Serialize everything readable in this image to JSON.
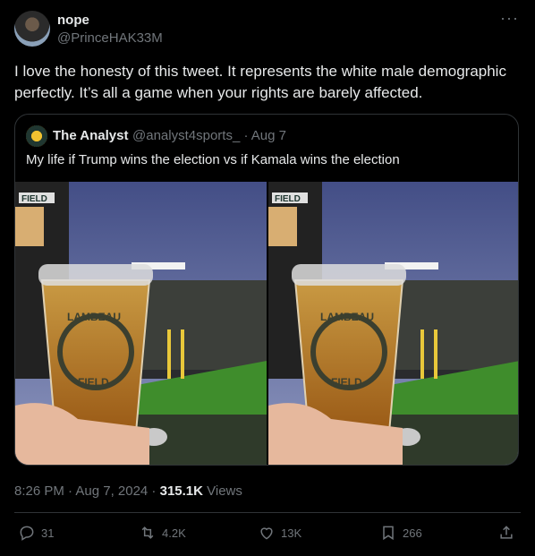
{
  "tweet": {
    "author_name": "nope",
    "author_handle": "@PrinceHAK33M",
    "more_icon": "more-dots-icon",
    "text": "I love the honesty of this tweet. It represents the white male demographic perfectly. It’s all a game when your rights are barely affected.",
    "timestamp": "8:26 PM · Aug 7, 2024 · ",
    "views_count": "315.1K",
    "views_label": " Views"
  },
  "quote": {
    "author_name": "The Analyst",
    "author_meta": "@analyst4sports_ · Aug 7",
    "text": "My life if Trump wins the election vs if Kamala wins the election",
    "media_texts": {
      "scoreboard": "FIELD",
      "cup_logo_top": "LAMBEAU",
      "cup_logo_bottom": "FIELD"
    }
  },
  "actions": {
    "reply_count": "31",
    "retweet_count": "4.2K",
    "like_count": "13K",
    "bookmark_count": "266"
  },
  "colors": {
    "background": "#000000",
    "text_primary": "#e7e9ea",
    "text_secondary": "#71767b",
    "border": "#2f3336"
  }
}
